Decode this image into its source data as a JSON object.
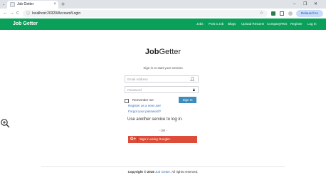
{
  "browser": {
    "tab_title": "Job Getter",
    "tab_close": "×",
    "new_tab": "+",
    "window_controls": {
      "minimize": "–",
      "restore": "❐",
      "close": "✕"
    },
    "back": "←",
    "forward": "→",
    "reload": "C",
    "home": "⌂",
    "url": "localhost:20320/Account/Login",
    "relaunch_label": "Relaunch to update"
  },
  "header": {
    "brand": "Job Getter",
    "nav": [
      "Jobs",
      "Post a Job",
      "Blogs",
      "Upload Resume",
      "CompanyRKS",
      "Register",
      "Log In"
    ]
  },
  "login": {
    "logo_job": "Job",
    "logo_getter": "Getter",
    "subtitle": "Sign in to start your session",
    "email_placeholder": "Email Address",
    "password_placeholder": "Password",
    "remember_label": "Remember me",
    "signin_label": "Sign In",
    "register_link": "Register as a new user",
    "forgot_link": "Forgot your password?",
    "another_service": "Use another service to log in.",
    "or_label": "- OR -",
    "google_label": "Sign in using Google+"
  },
  "footer": {
    "copyright": "Copyright © 2019",
    "brand": "Job Getter.",
    "rights": "All rights reserved."
  },
  "colors": {
    "header_green": "#0aa05a",
    "signin_blue": "#3c8dbc",
    "google_red": "#dd4b39",
    "link_blue": "#3c6fb5"
  },
  "icons": {
    "email": "user-icon",
    "password": "lock-icon",
    "zoom": "zoom-in-icon"
  }
}
